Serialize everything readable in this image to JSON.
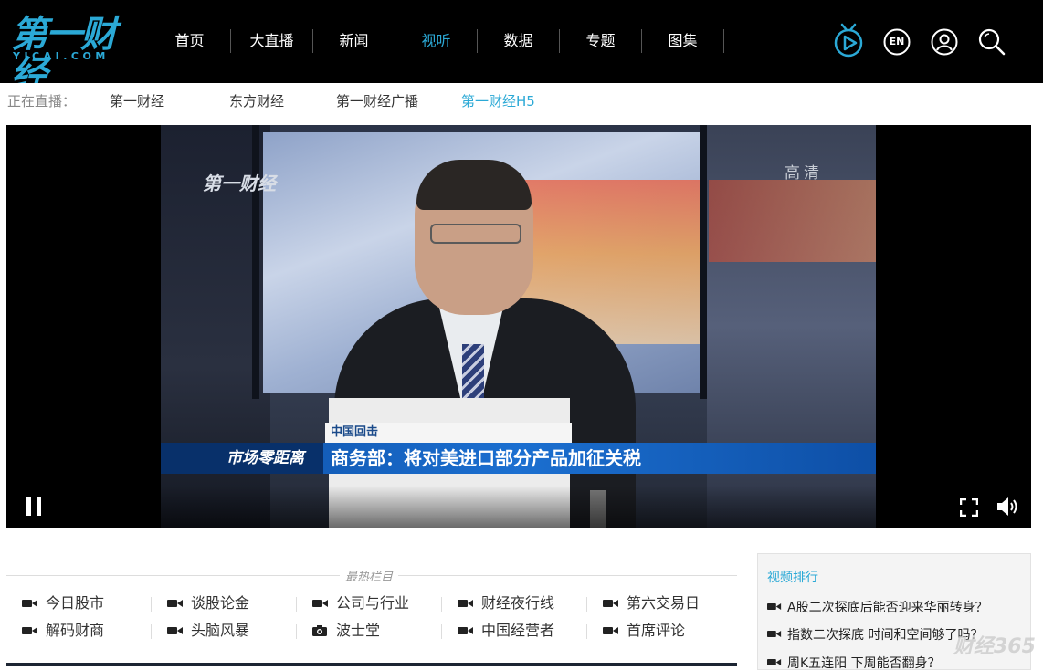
{
  "header": {
    "logo_text": "第一财经",
    "logo_sub": "YICAI.COM",
    "nav": [
      {
        "label": "首页",
        "active": false
      },
      {
        "label": "大直播",
        "active": false
      },
      {
        "label": "新闻",
        "active": false
      },
      {
        "label": "视听",
        "active": true
      },
      {
        "label": "数据",
        "active": false
      },
      {
        "label": "专题",
        "active": false
      },
      {
        "label": "图集",
        "active": false
      }
    ],
    "tools": [
      {
        "name": "tv-icon"
      },
      {
        "name": "en",
        "label": "EN"
      },
      {
        "name": "user-icon"
      },
      {
        "name": "search-icon"
      }
    ],
    "accent": "#2ba9d6"
  },
  "live": {
    "label": "正在直播：",
    "channels": [
      {
        "label": "第一财经",
        "active": false
      },
      {
        "label": "东方财经",
        "active": false
      },
      {
        "label": "第一财经广播",
        "active": false
      },
      {
        "label": "第一财经H5",
        "active": true
      }
    ]
  },
  "player": {
    "watermark_logo": "第一财经",
    "watermark_hd": "高清",
    "tag": "中国回击",
    "program": "市场零距离",
    "headline": "商务部：将对美进口部分产品加征关税",
    "controls": {
      "pause": "pause-icon",
      "fullscreen": "fullscreen-icon",
      "volume": "volume-icon"
    }
  },
  "hot": {
    "title": "最热栏目",
    "items": [
      {
        "label": "今日股市",
        "icon": "video-camera-icon"
      },
      {
        "label": "谈股论金",
        "icon": "video-camera-icon"
      },
      {
        "label": "公司与行业",
        "icon": "video-camera-icon"
      },
      {
        "label": "财经夜行线",
        "icon": "video-camera-icon"
      },
      {
        "label": "第六交易日",
        "icon": "video-camera-icon"
      },
      {
        "label": "解码财商",
        "icon": "video-camera-icon"
      },
      {
        "label": "头脑风暴",
        "icon": "video-camera-icon"
      },
      {
        "label": "波士堂",
        "icon": "photo-camera-icon"
      },
      {
        "label": "中国经营者",
        "icon": "video-camera-icon"
      },
      {
        "label": "首席评论",
        "icon": "video-camera-icon"
      }
    ]
  },
  "ranking": {
    "title": "视频排行",
    "items": [
      {
        "label": "A股二次探底后能否迎来华丽转身？"
      },
      {
        "label": "指数二次探底 时间和空间够了吗？"
      },
      {
        "label": "周K五连阳 下周能否翻身？"
      }
    ]
  },
  "site_watermark": "财经365"
}
